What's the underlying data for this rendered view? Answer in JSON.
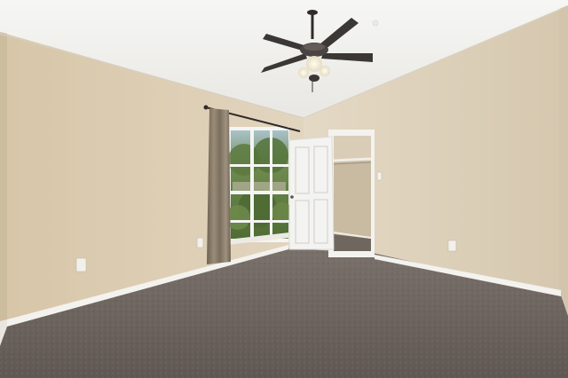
{
  "scene": {
    "subject": "empty-bedroom-with-vaulted-ceiling",
    "colors": {
      "ceiling": "#f1f1ee",
      "wall_left": "#dccdb2",
      "wall_right": "#ded1ba",
      "wall_far": "#e3d8c4",
      "carpet": "#6e6560",
      "baseboard": "#f4f2ee",
      "door": "#f3f3f1",
      "curtain": "#857866",
      "window_frame": "#f5f5f3",
      "tree_green": "#5c7a3e",
      "closet_interior": "#c9bba2",
      "fan_metal": "#3b3735",
      "fan_light": "#f3efe3"
    },
    "objects": {
      "ceiling_fan": {
        "blades": 5,
        "lights": 3
      },
      "window": {
        "panes_wide": 3,
        "panes_high": 4
      },
      "outlets": 3
    }
  }
}
